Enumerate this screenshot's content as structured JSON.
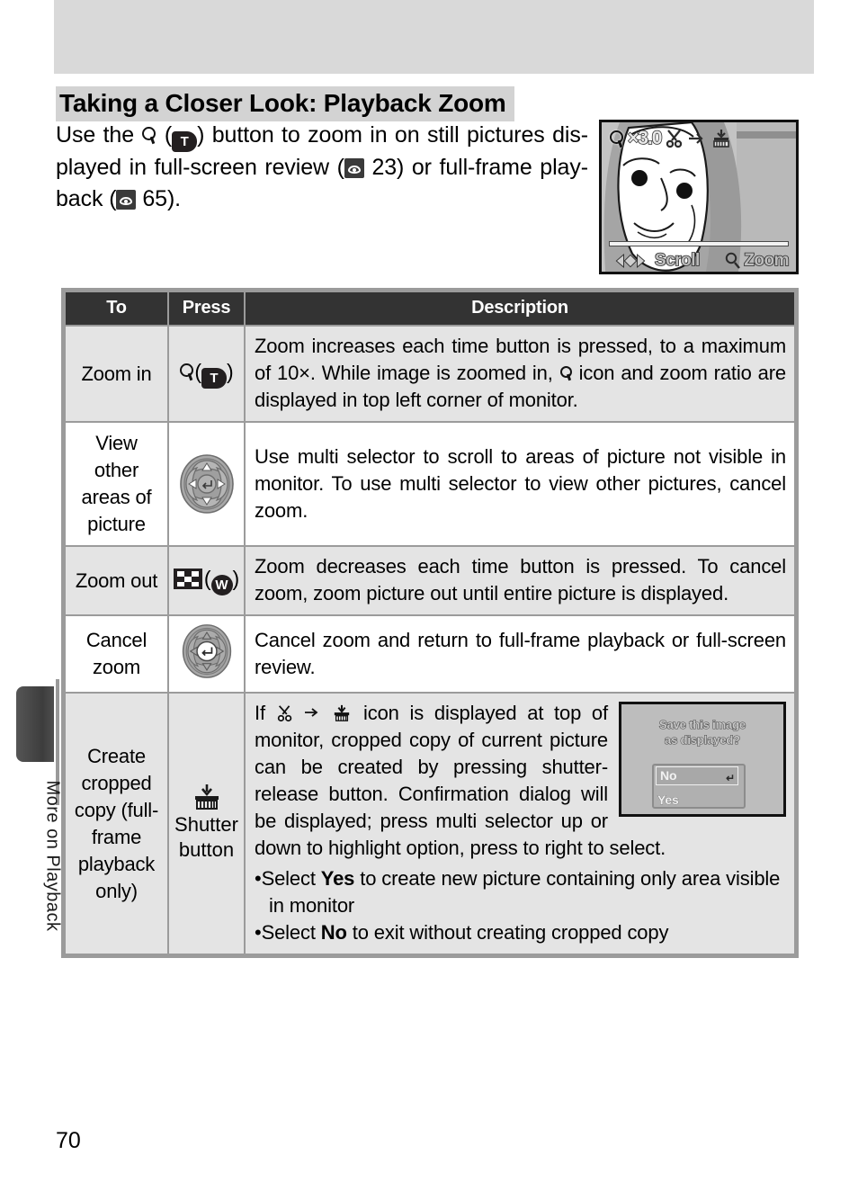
{
  "page": {
    "number": "70",
    "side_tab_label": "More on Playback"
  },
  "heading": "Taking a Closer Look: Playback Zoom",
  "intro": {
    "line1_a": "Use the",
    "line1_b": "(",
    "line1_c": ") button to zoom in on still pictures dis-",
    "line2_a": "played in full-screen review (",
    "line2_b": "23) or full-frame play-",
    "line3_a": "back (",
    "line3_b": "65)."
  },
  "monitor": {
    "zoom_ratio": "×3.0",
    "magnifier_icon": "magnifier-icon",
    "scissors_icon": "scissors-icon",
    "arrow_icon": "arrow-right-icon",
    "crop_icon": "crop-save-icon",
    "scroll_label": "Scroll",
    "zoom_label": "Zoom"
  },
  "table": {
    "headers": [
      "To",
      "Press",
      "Description"
    ],
    "rows": [
      {
        "to": "Zoom in",
        "press_icon": "magnifier-T-button",
        "press_text": "",
        "desc": "Zoom increases each time button is pressed, to a maximum of 10×.  While image is zoomed in,  icon and zoom ratio are displayed in top left corner of monitor.",
        "desc_part1": "Zoom increases each time button is pressed, to a maximum of 10",
        "desc_part2": ".  While image is zoomed in,",
        "desc_part3": "icon and zoom ratio are displayed in top left corner of monitor.",
        "shaded": true
      },
      {
        "to": "View other areas of picture",
        "press_icon": "multi-selector-arrows",
        "desc": "Use multi selector to scroll to areas of picture not visible in monitor.  To use multi selector to view other pictures, cancel zoom.",
        "shaded": false
      },
      {
        "to": "Zoom out",
        "press_icon": "thumbnail-W-button",
        "desc": "Zoom decreases each time button is pressed.  To cancel zoom, zoom picture out until entire picture is displayed.",
        "shaded": true
      },
      {
        "to": "Cancel zoom",
        "press_icon": "multi-selector-center",
        "desc": "Cancel zoom and return to full-frame playback or full-screen review.",
        "shaded": false
      },
      {
        "to": "Create cropped copy (full-frame playback only)",
        "press_icon": "shutter-button-icon",
        "press_label_line1": "Shutter",
        "press_label_line2": "button",
        "desc_intro_a": "If",
        "desc_intro_b": "icon is displayed at top of monitor, cropped copy of current picture can be created by pressing shutter-release button. Confirmation dialog will be displayed; press multi selector up or down to highlight option, press to right to select.",
        "bullet1_a": "Select",
        "bullet1_bold": "Yes",
        "bullet1_b": "to create new picture containing only area visible in monitor",
        "bullet2_a": "Select",
        "bullet2_bold": "No",
        "bullet2_b": "to exit without creating cropped copy",
        "shaded": true
      }
    ]
  },
  "dialog": {
    "title_line1": "Save this image",
    "title_line2": "as displayed?",
    "option_no": "No",
    "option_yes": "Yes",
    "enter_icon": "enter-arrow-icon"
  },
  "colors": {
    "header_band": "#d9d9d9",
    "heading_highlight": "#d3d3d3",
    "table_header_bg": "#333333",
    "table_border": "#9b9b9b",
    "row_shade": "#e4e4e4"
  }
}
